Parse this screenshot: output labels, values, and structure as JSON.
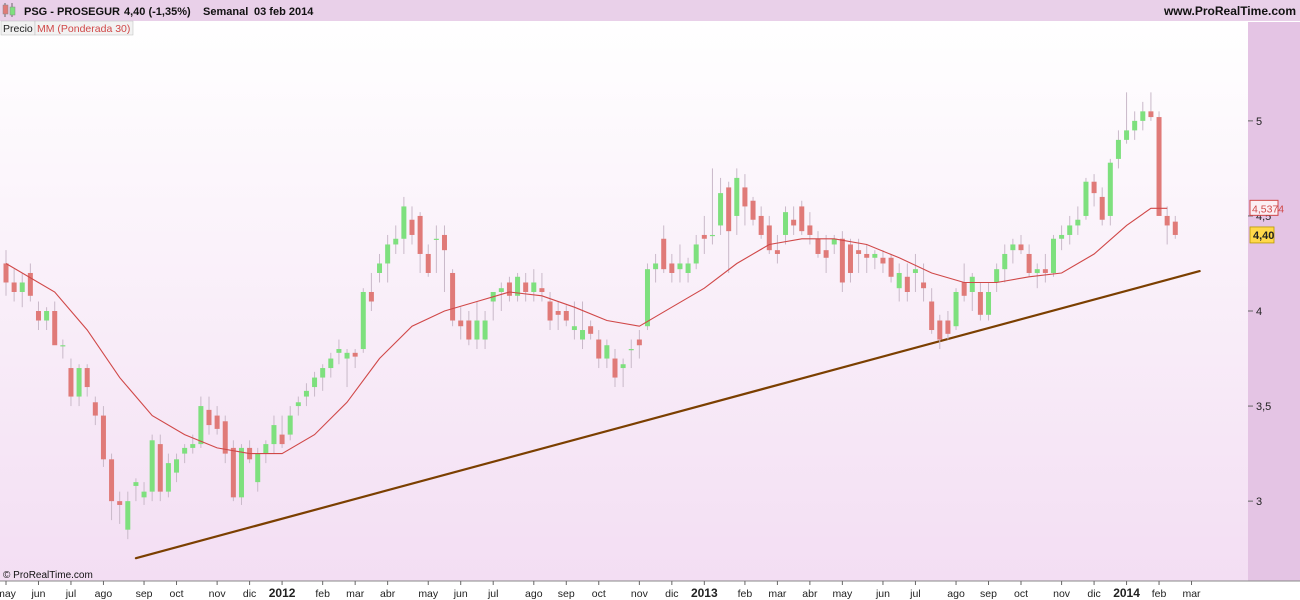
{
  "header": {
    "symbol": "PSG - PROSEGUR",
    "quote": "4,40 (-1,35%)",
    "period": "Semanal",
    "date": "03 feb 2014",
    "site": "www.ProRealTime.com"
  },
  "legend": {
    "price_label": "Precio",
    "ma_label": "MM (Ponderada 30)"
  },
  "footer": {
    "copyright": "© ProRealTime.com"
  },
  "colors": {
    "up": "#7ee07e",
    "down": "#e07a78",
    "ma": "#d04848",
    "trend": "#7b3f00",
    "grid_bg_top": "#ffffff",
    "grid_bg_bottom": "#f3def3",
    "right_panel": "#e4c4e4",
    "ma_badge_border": "#d04848",
    "price_badge": "#ffd84a"
  },
  "chart_data": {
    "type": "candlestick",
    "title": "PSG - PROSEGUR",
    "timeframe": "Semanal",
    "ylim": [
      2.58,
      5.52
    ],
    "y_ticks": [
      3,
      3.5,
      4,
      4.5,
      5
    ],
    "y_tick_labels": [
      "3",
      "3,5",
      "4",
      "4,5",
      "5"
    ],
    "x_labels": [
      {
        "label": "may",
        "i": 0,
        "bold": false
      },
      {
        "label": "jun",
        "i": 4,
        "bold": false
      },
      {
        "label": "jul",
        "i": 8,
        "bold": false
      },
      {
        "label": "ago",
        "i": 12,
        "bold": false
      },
      {
        "label": "sep",
        "i": 17,
        "bold": false
      },
      {
        "label": "oct",
        "i": 21,
        "bold": false
      },
      {
        "label": "nov",
        "i": 26,
        "bold": false
      },
      {
        "label": "dic",
        "i": 30,
        "bold": false
      },
      {
        "label": "2012",
        "i": 34,
        "bold": true
      },
      {
        "label": "feb",
        "i": 39,
        "bold": false
      },
      {
        "label": "mar",
        "i": 43,
        "bold": false
      },
      {
        "label": "abr",
        "i": 47,
        "bold": false
      },
      {
        "label": "may",
        "i": 52,
        "bold": false
      },
      {
        "label": "jun",
        "i": 56,
        "bold": false
      },
      {
        "label": "jul",
        "i": 60,
        "bold": false
      },
      {
        "label": "ago",
        "i": 65,
        "bold": false
      },
      {
        "label": "sep",
        "i": 69,
        "bold": false
      },
      {
        "label": "oct",
        "i": 73,
        "bold": false
      },
      {
        "label": "nov",
        "i": 78,
        "bold": false
      },
      {
        "label": "dic",
        "i": 82,
        "bold": false
      },
      {
        "label": "2013",
        "i": 86,
        "bold": true
      },
      {
        "label": "feb",
        "i": 91,
        "bold": false
      },
      {
        "label": "mar",
        "i": 95,
        "bold": false
      },
      {
        "label": "abr",
        "i": 99,
        "bold": false
      },
      {
        "label": "may",
        "i": 103,
        "bold": false
      },
      {
        "label": "jun",
        "i": 108,
        "bold": false
      },
      {
        "label": "jul",
        "i": 112,
        "bold": false
      },
      {
        "label": "ago",
        "i": 117,
        "bold": false
      },
      {
        "label": "sep",
        "i": 121,
        "bold": false
      },
      {
        "label": "oct",
        "i": 125,
        "bold": false
      },
      {
        "label": "nov",
        "i": 130,
        "bold": false
      },
      {
        "label": "dic",
        "i": 134,
        "bold": false
      },
      {
        "label": "2014",
        "i": 138,
        "bold": true
      },
      {
        "label": "feb",
        "i": 142,
        "bold": false
      },
      {
        "label": "mar",
        "i": 146,
        "bold": false
      }
    ],
    "candles": [
      [
        4.25,
        4.32,
        4.08,
        4.15
      ],
      [
        4.15,
        4.22,
        4.05,
        4.1
      ],
      [
        4.1,
        4.2,
        4.02,
        4.15
      ],
      [
        4.2,
        4.25,
        4.05,
        4.08
      ],
      [
        4.0,
        4.05,
        3.9,
        3.95
      ],
      [
        3.95,
        4.02,
        3.9,
        4.0
      ],
      [
        4.0,
        4.05,
        3.85,
        3.82
      ],
      [
        3.82,
        3.85,
        3.75,
        3.82
      ],
      [
        3.7,
        3.75,
        3.5,
        3.55
      ],
      [
        3.55,
        3.72,
        3.5,
        3.7
      ],
      [
        3.7,
        3.72,
        3.55,
        3.6
      ],
      [
        3.52,
        3.55,
        3.4,
        3.45
      ],
      [
        3.45,
        3.5,
        3.18,
        3.22
      ],
      [
        3.22,
        3.25,
        2.9,
        3.0
      ],
      [
        3.0,
        3.05,
        2.88,
        2.98
      ],
      [
        2.85,
        3.05,
        2.8,
        3.0
      ],
      [
        3.08,
        3.12,
        3.0,
        3.1
      ],
      [
        3.02,
        3.1,
        2.98,
        3.05
      ],
      [
        3.05,
        3.35,
        3.0,
        3.32
      ],
      [
        3.3,
        3.35,
        3.0,
        3.05
      ],
      [
        3.05,
        3.25,
        3.02,
        3.2
      ],
      [
        3.15,
        3.25,
        3.1,
        3.22
      ],
      [
        3.25,
        3.3,
        3.2,
        3.28
      ],
      [
        3.28,
        3.35,
        3.25,
        3.3
      ],
      [
        3.3,
        3.55,
        3.28,
        3.5
      ],
      [
        3.48,
        3.55,
        3.35,
        3.4
      ],
      [
        3.45,
        3.5,
        3.35,
        3.38
      ],
      [
        3.42,
        3.45,
        3.2,
        3.25
      ],
      [
        3.28,
        3.32,
        3.0,
        3.02
      ],
      [
        3.02,
        3.3,
        2.98,
        3.28
      ],
      [
        3.28,
        3.32,
        3.2,
        3.22
      ],
      [
        3.1,
        3.28,
        3.05,
        3.25
      ],
      [
        3.25,
        3.32,
        3.2,
        3.3
      ],
      [
        3.3,
        3.45,
        3.25,
        3.4
      ],
      [
        3.35,
        3.45,
        3.28,
        3.3
      ],
      [
        3.35,
        3.5,
        3.32,
        3.45
      ],
      [
        3.5,
        3.55,
        3.45,
        3.52
      ],
      [
        3.55,
        3.62,
        3.5,
        3.58
      ],
      [
        3.6,
        3.68,
        3.55,
        3.65
      ],
      [
        3.65,
        3.72,
        3.58,
        3.7
      ],
      [
        3.7,
        3.78,
        3.65,
        3.75
      ],
      [
        3.78,
        3.85,
        3.72,
        3.8
      ],
      [
        3.75,
        3.8,
        3.6,
        3.78
      ],
      [
        3.78,
        3.8,
        3.7,
        3.76
      ],
      [
        3.8,
        4.12,
        3.78,
        4.1
      ],
      [
        4.1,
        4.2,
        4.0,
        4.05
      ],
      [
        4.2,
        4.3,
        4.15,
        4.25
      ],
      [
        4.25,
        4.4,
        4.15,
        4.35
      ],
      [
        4.35,
        4.45,
        4.3,
        4.38
      ],
      [
        4.38,
        4.6,
        4.3,
        4.55
      ],
      [
        4.48,
        4.55,
        4.35,
        4.4
      ],
      [
        4.5,
        4.52,
        4.2,
        4.3
      ],
      [
        4.3,
        4.35,
        4.18,
        4.2
      ],
      [
        4.38,
        4.45,
        4.2,
        4.38
      ],
      [
        4.4,
        4.45,
        4.1,
        4.32
      ],
      [
        4.2,
        4.22,
        3.92,
        3.95
      ],
      [
        3.95,
        4.02,
        3.85,
        3.92
      ],
      [
        3.95,
        4.0,
        3.82,
        3.85
      ],
      [
        3.85,
        4.05,
        3.8,
        3.95
      ],
      [
        3.85,
        4.0,
        3.8,
        3.95
      ],
      [
        4.05,
        4.1,
        3.95,
        4.1
      ],
      [
        4.1,
        4.15,
        4.0,
        4.12
      ],
      [
        4.15,
        4.18,
        4.05,
        4.08
      ],
      [
        4.08,
        4.2,
        4.05,
        4.18
      ],
      [
        4.15,
        4.2,
        4.05,
        4.1
      ],
      [
        4.1,
        4.22,
        4.05,
        4.15
      ],
      [
        4.12,
        4.2,
        4.05,
        4.1
      ],
      [
        4.05,
        4.1,
        3.9,
        3.95
      ],
      [
        4.0,
        4.05,
        3.9,
        3.98
      ],
      [
        4.0,
        4.03,
        3.92,
        3.95
      ],
      [
        3.9,
        4.05,
        3.85,
        3.92
      ],
      [
        3.85,
        4.05,
        3.8,
        3.9
      ],
      [
        3.92,
        3.95,
        3.85,
        3.88
      ],
      [
        3.85,
        3.9,
        3.7,
        3.75
      ],
      [
        3.75,
        3.85,
        3.7,
        3.82
      ],
      [
        3.75,
        3.8,
        3.6,
        3.65
      ],
      [
        3.7,
        3.75,
        3.6,
        3.72
      ],
      [
        3.8,
        3.85,
        3.7,
        3.8
      ],
      [
        3.85,
        3.9,
        3.75,
        3.82
      ],
      [
        3.92,
        4.25,
        3.9,
        4.22
      ],
      [
        4.22,
        4.3,
        4.15,
        4.25
      ],
      [
        4.38,
        4.45,
        4.2,
        4.22
      ],
      [
        4.25,
        4.3,
        4.15,
        4.2
      ],
      [
        4.22,
        4.35,
        4.15,
        4.25
      ],
      [
        4.2,
        4.28,
        4.15,
        4.25
      ],
      [
        4.25,
        4.4,
        4.22,
        4.35
      ],
      [
        4.4,
        4.5,
        4.3,
        4.38
      ],
      [
        4.4,
        4.75,
        4.35,
        4.4
      ],
      [
        4.45,
        4.7,
        4.4,
        4.62
      ],
      [
        4.65,
        4.68,
        4.2,
        4.42
      ],
      [
        4.5,
        4.75,
        4.4,
        4.7
      ],
      [
        4.65,
        4.72,
        4.45,
        4.55
      ],
      [
        4.58,
        4.6,
        4.45,
        4.48
      ],
      [
        4.5,
        4.55,
        4.38,
        4.4
      ],
      [
        4.45,
        4.5,
        4.3,
        4.32
      ],
      [
        4.32,
        4.4,
        4.25,
        4.3
      ],
      [
        4.4,
        4.55,
        4.35,
        4.52
      ],
      [
        4.48,
        4.55,
        4.4,
        4.45
      ],
      [
        4.55,
        4.58,
        4.4,
        4.42
      ],
      [
        4.45,
        4.52,
        4.35,
        4.4
      ],
      [
        4.38,
        4.42,
        4.28,
        4.3
      ],
      [
        4.32,
        4.4,
        4.2,
        4.28
      ],
      [
        4.35,
        4.4,
        4.3,
        4.38
      ],
      [
        4.38,
        4.42,
        4.1,
        4.15
      ],
      [
        4.35,
        4.38,
        4.15,
        4.2
      ],
      [
        4.32,
        4.38,
        4.2,
        4.3
      ],
      [
        4.3,
        4.35,
        4.2,
        4.28
      ],
      [
        4.28,
        4.32,
        4.22,
        4.3
      ],
      [
        4.28,
        4.32,
        4.2,
        4.25
      ],
      [
        4.28,
        4.3,
        4.15,
        4.18
      ],
      [
        4.12,
        4.25,
        4.05,
        4.2
      ],
      [
        4.18,
        4.25,
        4.05,
        4.1
      ],
      [
        4.2,
        4.3,
        4.1,
        4.22
      ],
      [
        4.15,
        4.25,
        4.05,
        4.12
      ],
      [
        4.05,
        4.12,
        3.88,
        3.9
      ],
      [
        3.95,
        3.98,
        3.8,
        3.85
      ],
      [
        3.95,
        4.0,
        3.85,
        3.88
      ],
      [
        3.92,
        4.12,
        3.9,
        4.1
      ],
      [
        4.15,
        4.25,
        4.05,
        4.08
      ],
      [
        4.1,
        4.2,
        4.0,
        4.18
      ],
      [
        4.1,
        4.15,
        3.95,
        3.98
      ],
      [
        3.98,
        4.15,
        3.95,
        4.1
      ],
      [
        4.15,
        4.25,
        4.1,
        4.22
      ],
      [
        4.22,
        4.35,
        4.15,
        4.3
      ],
      [
        4.32,
        4.38,
        4.25,
        4.35
      ],
      [
        4.35,
        4.4,
        4.3,
        4.32
      ],
      [
        4.3,
        4.35,
        4.18,
        4.2
      ],
      [
        4.2,
        4.25,
        4.12,
        4.22
      ],
      [
        4.22,
        4.3,
        4.15,
        4.2
      ],
      [
        4.2,
        4.4,
        4.18,
        4.38
      ],
      [
        4.38,
        4.45,
        4.32,
        4.4
      ],
      [
        4.4,
        4.5,
        4.35,
        4.45
      ],
      [
        4.45,
        4.55,
        4.4,
        4.48
      ],
      [
        4.5,
        4.7,
        4.48,
        4.68
      ],
      [
        4.68,
        4.72,
        4.55,
        4.62
      ],
      [
        4.6,
        4.65,
        4.45,
        4.48
      ],
      [
        4.5,
        4.8,
        4.45,
        4.78
      ],
      [
        4.8,
        4.95,
        4.75,
        4.9
      ],
      [
        4.9,
        5.15,
        4.88,
        4.95
      ],
      [
        4.95,
        5.05,
        4.9,
        5.0
      ],
      [
        5.0,
        5.1,
        4.95,
        5.05
      ],
      [
        5.05,
        5.15,
        5.0,
        5.02
      ],
      [
        5.02,
        5.05,
        4.5,
        4.5
      ],
      [
        4.5,
        4.55,
        4.35,
        4.45
      ],
      [
        4.47,
        4.5,
        4.38,
        4.4
      ]
    ],
    "ma": {
      "name": "MM (Ponderada 30)",
      "last_value_label": "4,5374",
      "points": [
        [
          0,
          4.25
        ],
        [
          6,
          4.1
        ],
        [
          10,
          3.9
        ],
        [
          14,
          3.65
        ],
        [
          18,
          3.45
        ],
        [
          22,
          3.35
        ],
        [
          26,
          3.28
        ],
        [
          30,
          3.25
        ],
        [
          34,
          3.25
        ],
        [
          38,
          3.35
        ],
        [
          42,
          3.52
        ],
        [
          46,
          3.75
        ],
        [
          50,
          3.92
        ],
        [
          54,
          4.0
        ],
        [
          58,
          4.05
        ],
        [
          62,
          4.1
        ],
        [
          66,
          4.08
        ],
        [
          70,
          4.02
        ],
        [
          74,
          3.95
        ],
        [
          78,
          3.92
        ],
        [
          82,
          4.02
        ],
        [
          86,
          4.12
        ],
        [
          90,
          4.25
        ],
        [
          94,
          4.35
        ],
        [
          98,
          4.38
        ],
        [
          102,
          4.38
        ],
        [
          106,
          4.35
        ],
        [
          110,
          4.28
        ],
        [
          114,
          4.2
        ],
        [
          118,
          4.15
        ],
        [
          122,
          4.15
        ],
        [
          126,
          4.18
        ],
        [
          130,
          4.2
        ],
        [
          134,
          4.3
        ],
        [
          138,
          4.45
        ],
        [
          141,
          4.54
        ],
        [
          143,
          4.54
        ]
      ]
    },
    "trendline": [
      [
        16,
        2.7
      ],
      [
        147,
        4.21
      ]
    ],
    "last_price_label": "4,40"
  }
}
